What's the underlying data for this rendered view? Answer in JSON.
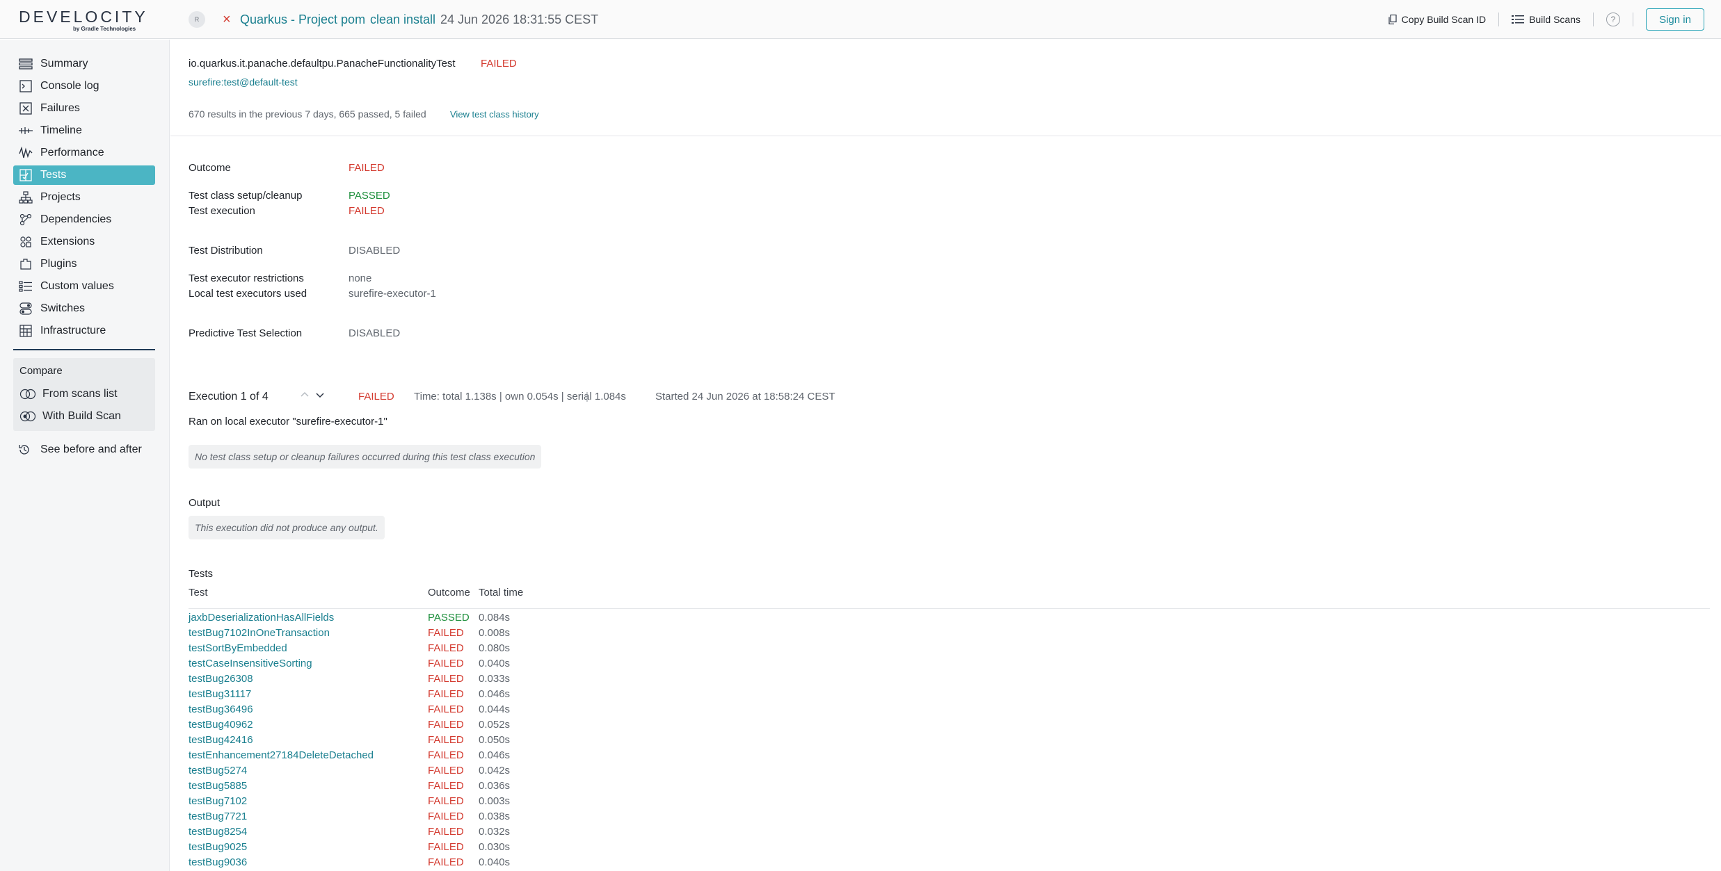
{
  "header": {
    "logo_text": "DEVELOCITY",
    "logo_sub": "by Gradle Technologies",
    "avatar": "R",
    "status_icon": "×",
    "project": "Quarkus - Project pom",
    "goal": "clean install",
    "date": "24 Jun 2026 18:31:55 CEST",
    "copy_id": "Copy Build Scan ID",
    "build_scans": "Build Scans",
    "help": "?",
    "sign_in": "Sign in"
  },
  "sidebar": {
    "items": [
      {
        "label": "Summary",
        "icon": "summary-icon"
      },
      {
        "label": "Console log",
        "icon": "console-log-icon"
      },
      {
        "label": "Failures",
        "icon": "failures-icon"
      },
      {
        "label": "Timeline",
        "icon": "timeline-icon"
      },
      {
        "label": "Performance",
        "icon": "performance-icon"
      },
      {
        "label": "Tests",
        "icon": "tests-icon",
        "active": true
      },
      {
        "label": "Projects",
        "icon": "projects-icon"
      },
      {
        "label": "Dependencies",
        "icon": "dependencies-icon"
      },
      {
        "label": "Extensions",
        "icon": "extensions-icon"
      },
      {
        "label": "Plugins",
        "icon": "plugins-icon"
      },
      {
        "label": "Custom values",
        "icon": "custom-values-icon"
      },
      {
        "label": "Switches",
        "icon": "switches-icon"
      },
      {
        "label": "Infrastructure",
        "icon": "infrastructure-icon"
      }
    ],
    "compare": {
      "title": "Compare",
      "from_list": "From scans list",
      "with_scan": "With Build Scan"
    },
    "see_before": "See before and after"
  },
  "test_class": {
    "name": "io.quarkus.it.panache.defaultpu.PanacheFunctionalityTest",
    "status": "FAILED",
    "task": "surefire:test@default-test",
    "history_summary": "670 results in the previous 7 days, 665 passed, 5 failed",
    "history_link": "View test class history"
  },
  "details": {
    "outcome_label": "Outcome",
    "outcome_value": "FAILED",
    "setup_label": "Test class setup/cleanup",
    "setup_value": "PASSED",
    "execution_label": "Test execution",
    "execution_value": "FAILED",
    "distribution_label": "Test Distribution",
    "distribution_value": "DISABLED",
    "restrictions_label": "Test executor restrictions",
    "restrictions_value": "none",
    "executors_label": "Local test executors used",
    "executors_value": "surefire-executor-1",
    "pts_label": "Predictive Test Selection",
    "pts_value": "DISABLED"
  },
  "execution": {
    "title": "Execution 1 of 4",
    "status": "FAILED",
    "time": "Time: total 1.138s | own 0.054s | serial 1.084s",
    "started": "Started 24 Jun 2026 at 18:58:24 CEST",
    "ran_on": "Ran on local executor \"surefire-executor-1\"",
    "setup_notice": "No test class setup or cleanup failures occurred during this test class execution",
    "output_title": "Output",
    "output_notice": "This execution did not produce any output."
  },
  "tests_table": {
    "title": "Tests",
    "columns": [
      "Test",
      "Outcome",
      "Total time"
    ],
    "rows": [
      {
        "name": "jaxbDeserializationHasAllFields",
        "outcome": "PASSED",
        "time": "0.084s"
      },
      {
        "name": "testBug7102InOneTransaction",
        "outcome": "FAILED",
        "time": "0.008s"
      },
      {
        "name": "testSortByEmbedded",
        "outcome": "FAILED",
        "time": "0.080s"
      },
      {
        "name": "testCaseInsensitiveSorting",
        "outcome": "FAILED",
        "time": "0.040s"
      },
      {
        "name": "testBug26308",
        "outcome": "FAILED",
        "time": "0.033s"
      },
      {
        "name": "testBug31117",
        "outcome": "FAILED",
        "time": "0.046s"
      },
      {
        "name": "testBug36496",
        "outcome": "FAILED",
        "time": "0.044s"
      },
      {
        "name": "testBug40962",
        "outcome": "FAILED",
        "time": "0.052s"
      },
      {
        "name": "testBug42416",
        "outcome": "FAILED",
        "time": "0.050s"
      },
      {
        "name": "testEnhancement27184DeleteDetached",
        "outcome": "FAILED",
        "time": "0.046s"
      },
      {
        "name": "testBug5274",
        "outcome": "FAILED",
        "time": "0.042s"
      },
      {
        "name": "testBug5885",
        "outcome": "FAILED",
        "time": "0.036s"
      },
      {
        "name": "testBug7102",
        "outcome": "FAILED",
        "time": "0.003s"
      },
      {
        "name": "testBug7721",
        "outcome": "FAILED",
        "time": "0.038s"
      },
      {
        "name": "testBug8254",
        "outcome": "FAILED",
        "time": "0.032s"
      },
      {
        "name": "testBug9025",
        "outcome": "FAILED",
        "time": "0.030s"
      },
      {
        "name": "testBug9036",
        "outcome": "FAILED",
        "time": "0.040s"
      }
    ]
  },
  "colors": {
    "accent": "#27a3b6",
    "link": "#1a7f8f",
    "failed": "#d33a2f",
    "passed": "#1e8f3c",
    "active_nav": "#4bb5c4"
  }
}
